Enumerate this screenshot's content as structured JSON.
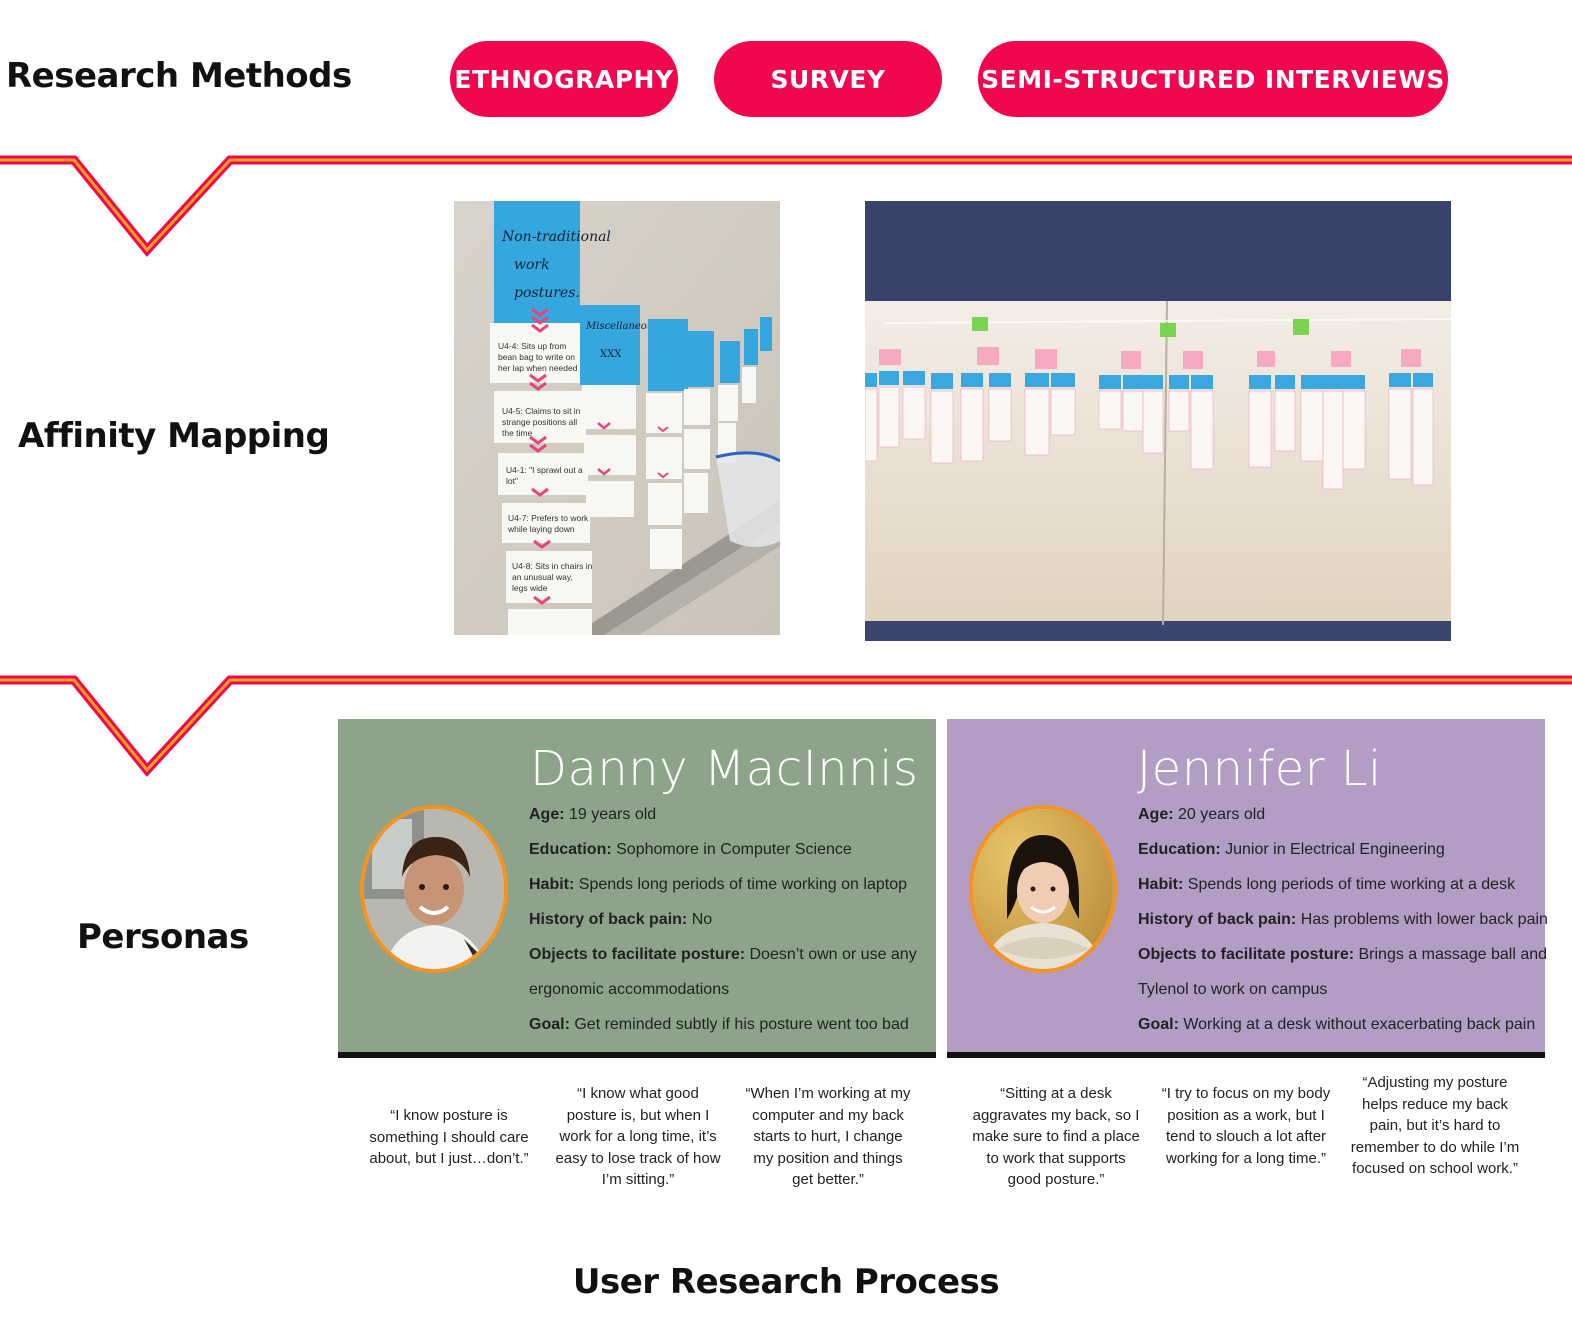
{
  "research_methods": {
    "label": "Research Methods",
    "pills": [
      "ETHNOGRAPHY",
      "SURVEY",
      "SEMI-STRUCTURED INTERVIEWS"
    ]
  },
  "affinity": {
    "label": "Affinity Mapping",
    "photo1_notes": {
      "heading": "Non-traditional work postures.",
      "misc": "Miscellaneous",
      "notes": [
        "U4-4: Sits up from bean bag to write on her lap when needed",
        "U4-5: Claims to sit in strange positions all the time",
        "U4-1: \"I sprawl out a lot\"",
        "U4-7: Prefers to work while laying down",
        "U4-8: Sits in chairs in an unusual way"
      ]
    }
  },
  "personas": {
    "label": "Personas",
    "cards": [
      {
        "name": "Danny MacInnis",
        "fields": [
          {
            "k": "Age:",
            "v": "19 years old"
          },
          {
            "k": "Education:",
            "v": "Sophomore in Computer Science"
          },
          {
            "k": "Habit:",
            "v": "Spends long periods of time working on laptop"
          },
          {
            "k": "History of back pain:",
            "v": "No"
          },
          {
            "k": "Objects to facilitate posture:",
            "v": "Doesn’t own or use any"
          },
          {
            "k": "",
            "v": "ergonomic accommodations"
          },
          {
            "k": "Goal:",
            "v": "Get reminded subtly if his posture went too bad"
          }
        ],
        "quotes": [
          "“I know posture is something I should care about, but I just…don’t.”",
          "“I know what good posture is, but when I work for a long time, it’s easy to lose track of how I’m sitting.”",
          "“When I’m working at my computer and my back starts to hurt, I change my position and things get better.”"
        ]
      },
      {
        "name": "Jennifer Li",
        "fields": [
          {
            "k": "Age:",
            "v": "20 years old"
          },
          {
            "k": "Education:",
            "v": "Junior in Electrical Engineering"
          },
          {
            "k": "Habit:",
            "v": "Spends long periods of time working at a desk"
          },
          {
            "k": "History of back pain:",
            "v": "Has problems with lower back pain"
          },
          {
            "k": "Objects to facilitate posture:",
            "v": "Brings a massage ball and"
          },
          {
            "k": "",
            "v": "Tylenol to work on campus"
          },
          {
            "k": "Goal:",
            "v": "Working at a desk without exacerbating back pain"
          }
        ],
        "quotes": [
          "“Sitting at a desk aggravates my back, so I make sure to find a place to work that supports good posture.”",
          "“I try to focus on my body position as a work, but I tend to slouch a lot after working for a long time.”",
          "“Adjusting my posture helps reduce my back pain, but it’s hard to remember to do while I’m focused on school work.”"
        ]
      }
    ]
  },
  "footer": {
    "title": "User Research Process"
  },
  "colors": {
    "accent": "#f0074e",
    "divider_outer": "#f0074e",
    "divider_inner": "#f7a21b",
    "persona1_bg": "#8da48b",
    "persona2_bg": "#b39dc4",
    "avatar_border": "#f39322"
  }
}
